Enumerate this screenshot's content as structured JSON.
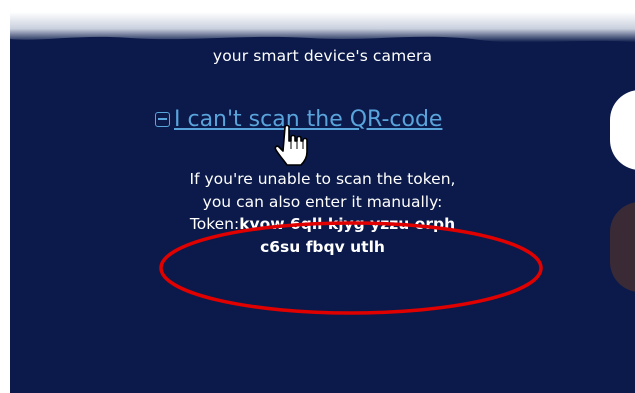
{
  "panel": {
    "bg_color": "#0b1a4a",
    "caption": "your smart device's camera"
  },
  "qr_toggle": {
    "icon": "collapse-box-icon",
    "link_text": "I can't scan the QR-code",
    "link_color": "#5aa4dc"
  },
  "cursor": {
    "icon": "hand-pointer-icon"
  },
  "manual_entry": {
    "line1": "If you're unable to scan the token,",
    "line2": "you can also enter it manually:",
    "token_label": "Token:",
    "token_value_line1": "kvow 6qll kjyg yzzu orph",
    "token_value_line2": "c6su fbqv utlh"
  },
  "annotation": {
    "shape": "ellipse",
    "color": "#e00000"
  }
}
